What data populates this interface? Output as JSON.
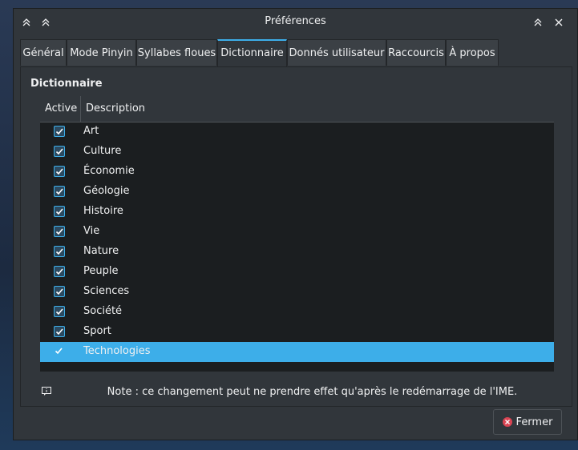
{
  "window": {
    "title": "Préférences"
  },
  "tabs": [
    {
      "label": "Général"
    },
    {
      "label": "Mode Pinyin"
    },
    {
      "label": "Syllabes floues"
    },
    {
      "label": "Dictionnaire"
    },
    {
      "label": "Donnés utilisateur"
    },
    {
      "label": "Raccourcis"
    },
    {
      "label": "À propos"
    }
  ],
  "active_tab": "Dictionnaire",
  "panel": {
    "title": "Dictionnaire",
    "columns": {
      "active": "Active",
      "description": "Description"
    },
    "rows": [
      {
        "label": "Art",
        "checked": true
      },
      {
        "label": "Culture",
        "checked": true
      },
      {
        "label": "Économie",
        "checked": true
      },
      {
        "label": "Géologie",
        "checked": true
      },
      {
        "label": "Histoire",
        "checked": true
      },
      {
        "label": "Vie",
        "checked": true
      },
      {
        "label": "Nature",
        "checked": true
      },
      {
        "label": "Peuple",
        "checked": true
      },
      {
        "label": "Sciences",
        "checked": true
      },
      {
        "label": "Société",
        "checked": true
      },
      {
        "label": "Sport",
        "checked": true
      },
      {
        "label": "Technologies",
        "checked": true,
        "selected": true
      }
    ],
    "note": "Note : ce changement peut ne prendre effet qu'après le redémarrage de l'IME."
  },
  "buttons": {
    "close": "Fermer"
  },
  "colors": {
    "accent": "#3daee9",
    "window_bg": "#31363b",
    "list_bg": "#1b1e20",
    "close_icon": "#da4453"
  }
}
